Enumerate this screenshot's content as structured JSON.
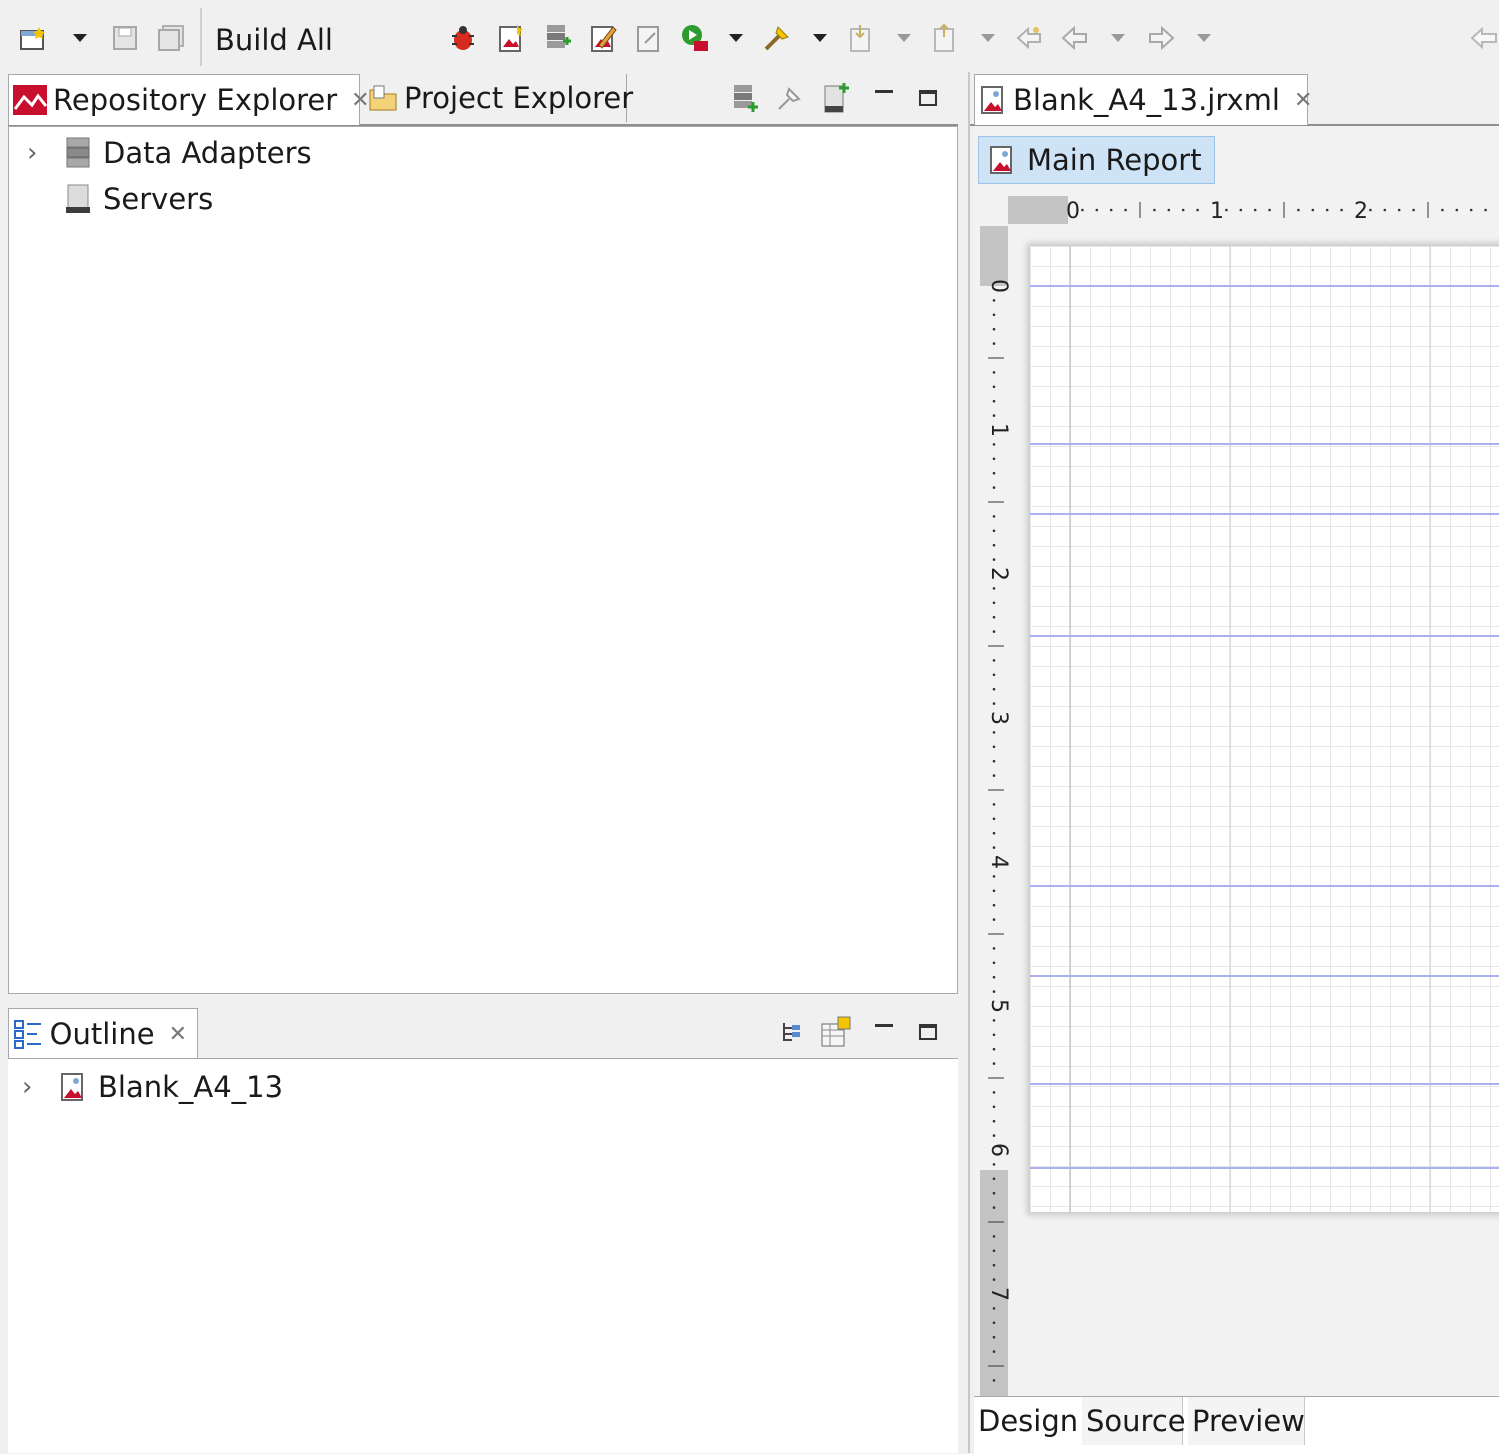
{
  "toolbar": {
    "build_all_label": "Build All",
    "icons": [
      "new-wizard-icon",
      "save-icon",
      "save-all-icon",
      "debug-icon",
      "new-report-icon",
      "new-data-adapter-icon",
      "edit-report-icon",
      "compile-icon",
      "run-icon",
      "external-tools-icon",
      "next-annotation-icon",
      "previous-annotation-icon",
      "last-edit-icon",
      "back-icon",
      "forward-icon",
      "pin-icon"
    ]
  },
  "repository_panel": {
    "tabs": [
      {
        "label": "Repository Explorer",
        "active": true
      },
      {
        "label": "Project Explorer",
        "active": false
      }
    ],
    "tree": [
      {
        "label": "Data Adapters",
        "expandable": true
      },
      {
        "label": "Servers",
        "expandable": false
      }
    ]
  },
  "outline_panel": {
    "tab_label": "Outline",
    "tree": [
      {
        "label": "Blank_A4_13",
        "expandable": true
      }
    ]
  },
  "editor": {
    "file_tab": "Blank_A4_13.jrxml",
    "main_report_label": "Main Report",
    "ruler_h_labels": [
      "0",
      "1",
      "2"
    ],
    "ruler_v_labels": [
      "0",
      "1",
      "2",
      "3",
      "4",
      "5",
      "6",
      "7"
    ],
    "bottom_tabs": [
      "Design",
      "Source",
      "Preview"
    ],
    "active_bottom_tab": "Design"
  },
  "colors": {
    "accent_red": "#c8102e",
    "band_line": "#aab0f0",
    "selection_blue": "#cfe3f7"
  }
}
